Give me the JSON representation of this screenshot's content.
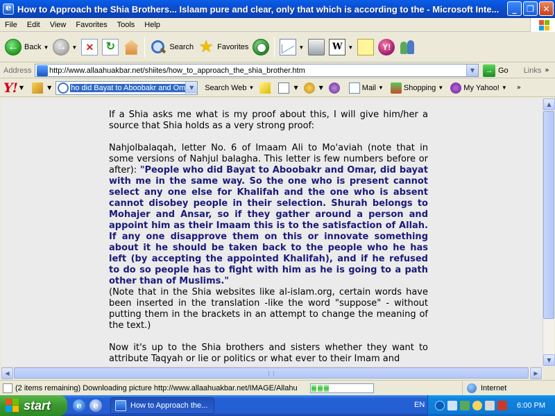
{
  "window": {
    "title": "How to Approach the Shia Brothers... Islaam pure and clear, only that which is according to the - Microsoft Inte...",
    "minimize": "_",
    "maximize": "❐",
    "close": "✕"
  },
  "menu": [
    "File",
    "Edit",
    "View",
    "Favorites",
    "Tools",
    "Help"
  ],
  "toolbar": {
    "back": "Back",
    "search": "Search",
    "favorites": "Favorites"
  },
  "address": {
    "label": "Address",
    "url": "http://www.allaahuakbar.net/shiites/how_to_approach_the_shia_brother.htm",
    "go": "Go",
    "links": "Links"
  },
  "yahoo": {
    "logo": "Y!",
    "search_value": "ho did Bayat to Aboobakr and Omar",
    "search_web": "Search Web",
    "mail": "Mail",
    "shopping": "Shopping",
    "my_yahoo": "My Yahoo!"
  },
  "article": {
    "p1": "If a Shia asks me what is my proof about this, I will give him/her a source that Shia holds as a very strong proof:",
    "p2_intro": "Nahjolbalaqah, letter No. 6 of Imaam Ali to Mo'aviah (note that in some versions of Nahjul balagha. This letter is few numbers before or after): ",
    "p2_quote": "\"People who did Bayat to Aboobakr and Omar, did bayat with me in the same way. So the one who is present cannot select any one else for Khalifah and the one who is absent cannot disobey people in their selection. Shurah belongs to Mohajer and Ansar, so if they gather around a person and appoint him as their Imaam this is to the satisfaction of Allah. If any one disapprove them on this or innovate something about it he should be taken back to the people who he has left (by accepting the appointed Khalifah), and if he refused to do so people has to fight with him as he is going to a path other than of Muslims.\"",
    "p2_note": "(Note that in the Shia websites like al-islam.org, certain words have been inserted in the translation -like the word \"suppose\" - without putting them in the brackets in an attempt to change the meaning of the text.)",
    "p3": "Now it's up to the Shia brothers and sisters whether they want to attribute Taqyah or lie or politics or what ever to their Imam and"
  },
  "status": {
    "text": "(2 items remaining) Downloading picture http://www.allaahuakbar.net/IMAGE/Allahu",
    "progress_segments": 3,
    "zone": "Internet"
  },
  "taskbar": {
    "start": "start",
    "task": "How to Approach the...",
    "lang": "EN",
    "clock": "6:00 PM"
  },
  "colors": {
    "title_bar": "#0b4fd0",
    "quote_text": "#1a1a7a",
    "content_bg": "#ebebeb",
    "taskbar": "#245ed1",
    "start_button": "#3b962f"
  }
}
